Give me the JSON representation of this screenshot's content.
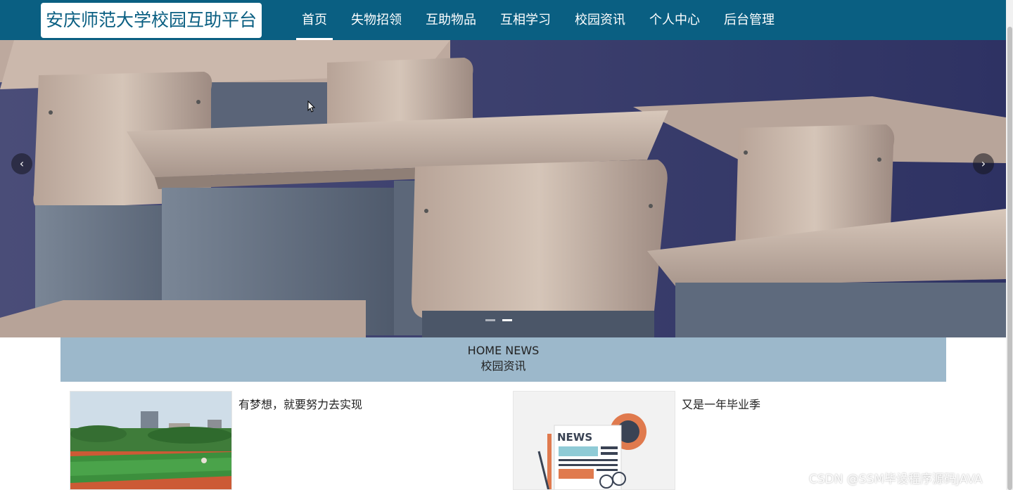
{
  "header": {
    "logo_text": "安庆师范大学校园互助平台",
    "nav": [
      {
        "label": "首页",
        "active": true
      },
      {
        "label": "失物招领",
        "active": false
      },
      {
        "label": "互助物品",
        "active": false
      },
      {
        "label": "互相学习",
        "active": false
      },
      {
        "label": "校园资讯",
        "active": false
      },
      {
        "label": "个人中心",
        "active": false
      },
      {
        "label": "后台管理",
        "active": false
      }
    ]
  },
  "carousel": {
    "prev_icon": "chevron-left-icon",
    "next_icon": "chevron-right-icon",
    "prev_glyph": "‹",
    "next_glyph": "›",
    "slide_count": 2,
    "active_index": 1
  },
  "news_section": {
    "title_en": "HOME NEWS",
    "title_cn": "校园资讯",
    "items": [
      {
        "title": "有梦想，就要努力去实现"
      },
      {
        "title": "又是一年毕业季",
        "image_text": "NEWS"
      }
    ]
  },
  "watermark": "CSDN @SSM毕设程序源码JAVA",
  "colors": {
    "header_bg": "#0a5f82",
    "section_bg": "#9cb8cb",
    "text": "#222222"
  }
}
